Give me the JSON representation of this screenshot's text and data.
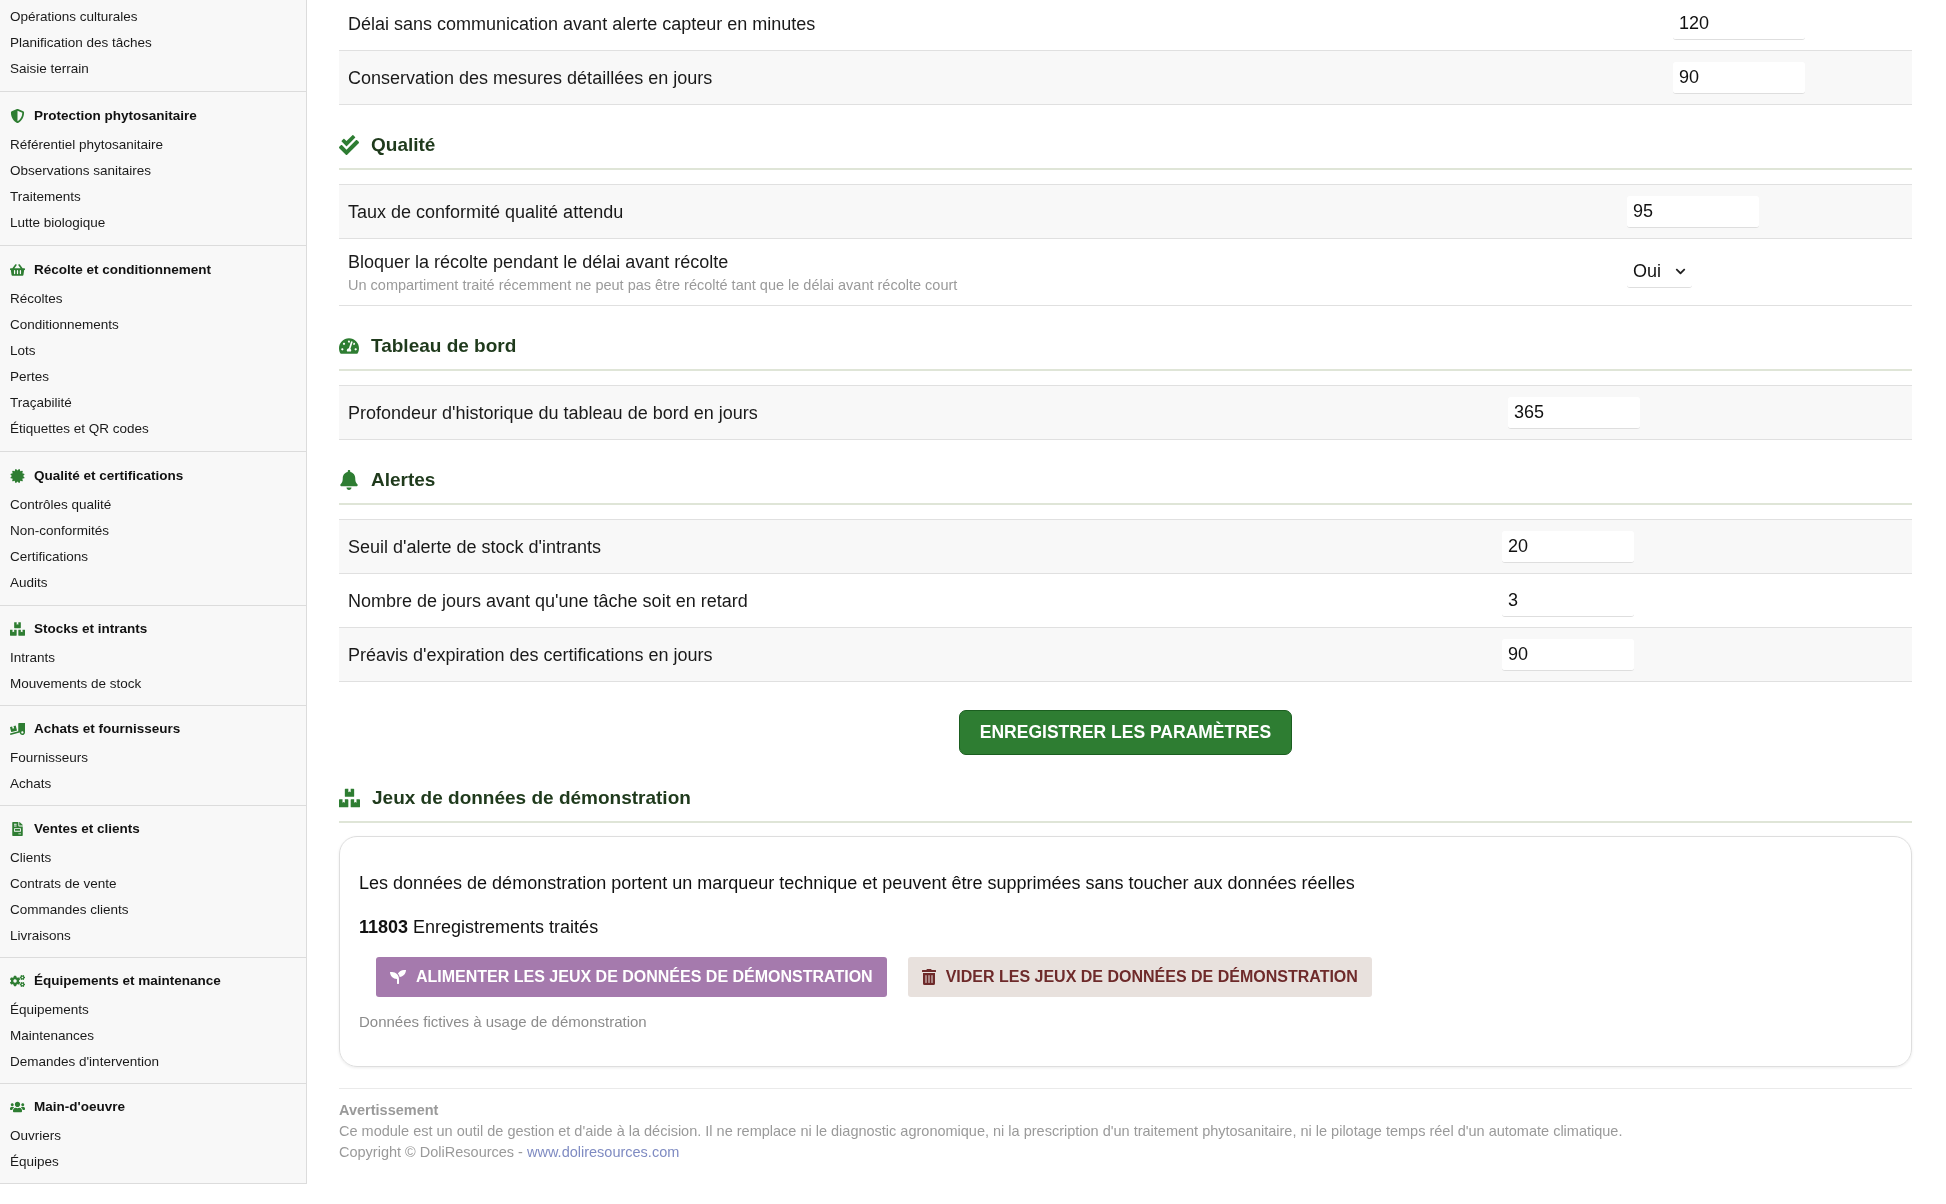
{
  "sidebar": {
    "groups": [
      {
        "items": [
          "Opérations culturales",
          "Planification des tâches",
          "Saisie terrain"
        ]
      },
      {
        "title": "Protection phytosanitaire",
        "items": [
          "Référentiel phytosanitaire",
          "Observations sanitaires",
          "Traitements",
          "Lutte biologique"
        ]
      },
      {
        "title": "Récolte et conditionnement",
        "items": [
          "Récoltes",
          "Conditionnements",
          "Lots",
          "Pertes",
          "Traçabilité",
          "Étiquettes et QR codes"
        ]
      },
      {
        "title": "Qualité et certifications",
        "items": [
          "Contrôles qualité",
          "Non-conformités",
          "Certifications",
          "Audits"
        ]
      },
      {
        "title": "Stocks et intrants",
        "items": [
          "Intrants",
          "Mouvements de stock"
        ]
      },
      {
        "title": "Achats et fournisseurs",
        "items": [
          "Fournisseurs",
          "Achats"
        ]
      },
      {
        "title": "Ventes et clients",
        "items": [
          "Clients",
          "Contrats de vente",
          "Commandes clients",
          "Livraisons"
        ]
      },
      {
        "title": "Équipements et maintenance",
        "items": [
          "Équipements",
          "Maintenances",
          "Demandes d'intervention"
        ]
      },
      {
        "title": "Main-d'oeuvre",
        "items": [
          "Ouvriers",
          "Équipes"
        ]
      }
    ]
  },
  "settings": {
    "sections": [
      {
        "rows": [
          {
            "kind": "number",
            "label": "Délai sans communication avant alerte capteur en minutes",
            "value": "120"
          },
          {
            "kind": "number",
            "label": "Conservation des mesures détaillées en jours",
            "value": "90"
          }
        ]
      },
      {
        "title": "Qualité",
        "rows": [
          {
            "kind": "number",
            "label": "Taux de conformité qualité attendu",
            "value": "95"
          },
          {
            "kind": "select",
            "label": "Bloquer la récolte pendant le délai avant récolte",
            "description": "Un compartiment traité récemment ne peut pas être récolté tant que le délai avant récolte court",
            "value": "Oui"
          }
        ]
      },
      {
        "title": "Tableau de bord",
        "rows": [
          {
            "kind": "number",
            "label": "Profondeur d'historique du tableau de bord en jours",
            "value": "365"
          }
        ]
      },
      {
        "title": "Alertes",
        "rows": [
          {
            "kind": "number",
            "label": "Seuil d'alerte de stock d'intrants",
            "value": "20"
          },
          {
            "kind": "number",
            "label": "Nombre de jours avant qu'une tâche soit en retard",
            "value": "3"
          },
          {
            "kind": "number",
            "label": "Préavis d'expiration des certifications en jours",
            "value": "90"
          }
        ]
      }
    ],
    "save_button": "ENREGISTRER LES PARAMÈTRES"
  },
  "demo": {
    "title": "Jeux de données de démonstration",
    "description": "Les données de démonstration portent un marqueur technique et peuvent être supprimées sans toucher aux données réelles",
    "count": "**11803** Enregistrements traités",
    "buttons": [
      {
        "kind": "fill",
        "label": "ALIMENTER LES JEUX DE DONNÉES DE DÉMONSTRATION"
      },
      {
        "kind": "clear",
        "label": "VIDER LES JEUX DE DONNÉES DE DÉMONSTRATION"
      }
    ],
    "note": "Données fictives à usage de démonstration"
  },
  "footer": {
    "title": "Avertissement",
    "text": "Ce module est un outil de gestion et d'aide à la décision. Il ne remplace ni le diagnostic agronomique, ni la prescription d'un traitement phytosanitaire, ni le pilotage temps réel d'un automate climatique.",
    "copyright": "Copyright © DoliResources -",
    "link": "www.doliresources.com"
  }
}
